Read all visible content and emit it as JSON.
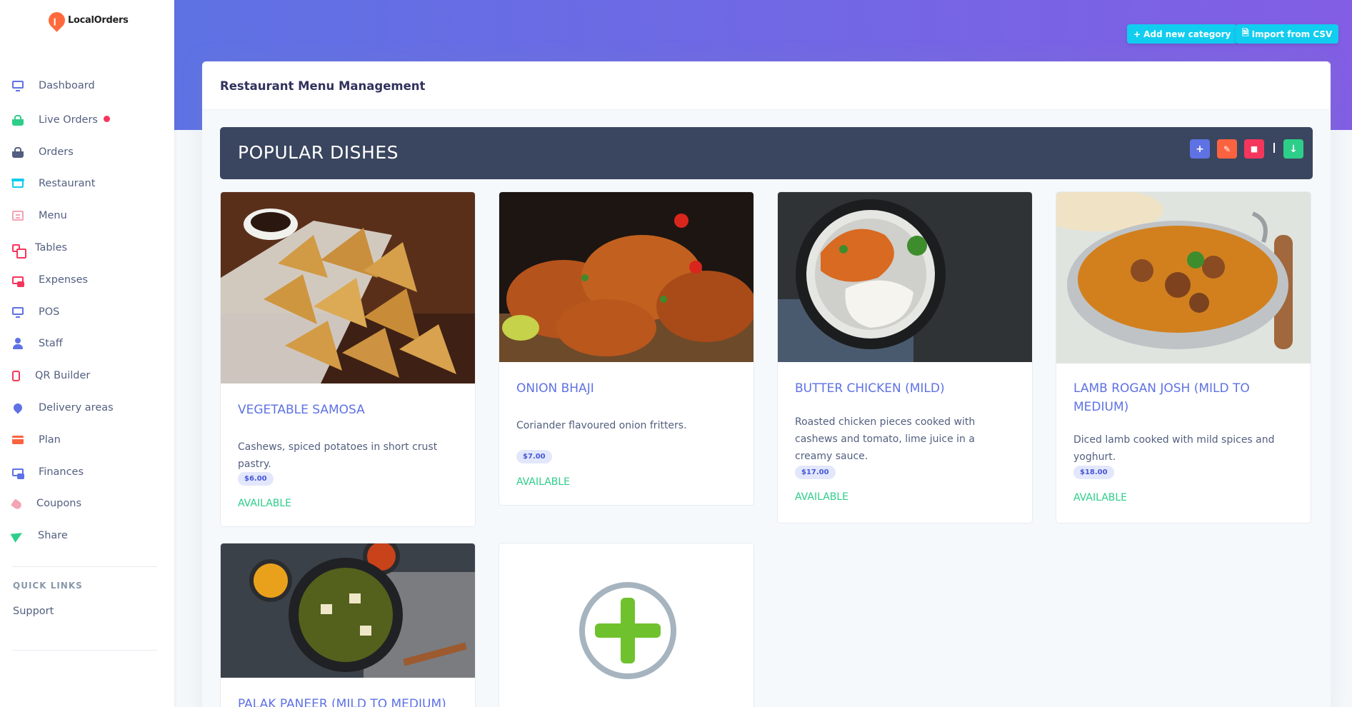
{
  "app": {
    "logo_text": "LocalOrders"
  },
  "sidebar": {
    "items": [
      {
        "label": "Dashboard",
        "icon": "monitor-icon"
      },
      {
        "label": "Live Orders",
        "icon": "basket-icon"
      },
      {
        "label": "Orders",
        "icon": "basket-icon"
      },
      {
        "label": "Restaurant",
        "icon": "shop-icon"
      },
      {
        "label": "Menu",
        "icon": "menu-icon"
      },
      {
        "label": "Tables",
        "icon": "tables-icon"
      },
      {
        "label": "Expenses",
        "icon": "expenses-icon"
      },
      {
        "label": "POS",
        "icon": "monitor-icon"
      },
      {
        "label": "Staff",
        "icon": "user-icon"
      },
      {
        "label": "QR Builder",
        "icon": "phone-icon"
      },
      {
        "label": "Delivery areas",
        "icon": "map-pin-icon"
      },
      {
        "label": "Plan",
        "icon": "credit-card-icon"
      },
      {
        "label": "Finances",
        "icon": "finance-icon"
      },
      {
        "label": "Coupons",
        "icon": "tag-icon"
      },
      {
        "label": "Share",
        "icon": "send-icon"
      }
    ],
    "quick_links_title": "QUICK LINKS",
    "support_label": "Support"
  },
  "header": {
    "add_category_label": "Add new category",
    "import_csv_label": "Import from CSV"
  },
  "panel": {
    "title": "Restaurant Menu Management"
  },
  "category": {
    "name": "POPULAR DISHES",
    "actions": [
      "add",
      "edit",
      "delete",
      "download"
    ]
  },
  "items": [
    {
      "name": "VEGETABLE SAMOSA",
      "description": "Cashews, spiced potatoes in short crust pastry.",
      "price": "$6.00",
      "status": "AVAILABLE"
    },
    {
      "name": "ONION BHAJI",
      "description": "Coriander flavoured onion fritters.",
      "price": "$7.00",
      "status": "AVAILABLE"
    },
    {
      "name": "BUTTER CHICKEN (MILD)",
      "description": "Roasted chicken pieces cooked with cashews and tomato, lime juice in a creamy sauce.",
      "price": "$17.00",
      "status": "AVAILABLE"
    },
    {
      "name": "LAMB ROGAN JOSH (MILD TO MEDIUM)",
      "description": "Diced lamb cooked with mild spices and yoghurt.",
      "price": "$18.00",
      "status": "AVAILABLE"
    },
    {
      "name": "PALAK PANEER (MILD TO MEDIUM)"
    }
  ],
  "colors": {
    "primary": "#5e72e4",
    "info": "#11cdef",
    "success": "#2dce89",
    "warning": "#fb6340",
    "danger": "#f5365c",
    "category_bar": "#3a465f"
  }
}
